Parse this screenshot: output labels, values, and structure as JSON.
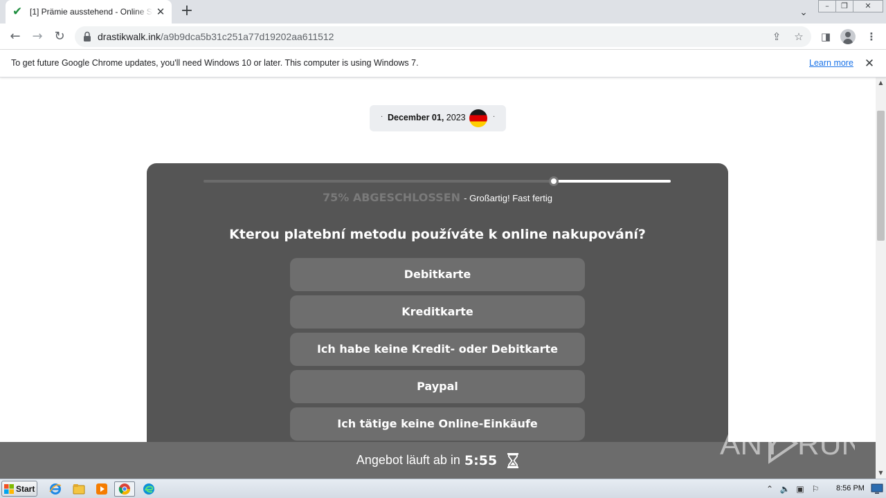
{
  "browser": {
    "tab_title": "[1] Prämie ausstehend - Online Survey",
    "url_host": "drastikwalk.ink",
    "url_path": "/a9b9dca5b31c251a77d19202aa611512"
  },
  "infobar": {
    "message": "To get future Google Chrome updates, you'll need Windows 10 or later. This computer is using Windows 7.",
    "link": "Learn more"
  },
  "page": {
    "date_bold": "December 01,",
    "date_year": "2023",
    "progress": {
      "percent": 75,
      "label": "75% ABGESCHLOSSEN",
      "subtext": "- Großartig! Fast fertig"
    },
    "question": "Kterou platební metodu používáte k online nakupování?",
    "answers": [
      "Debitkarte",
      "Kreditkarte",
      "Ich habe keine Kredit- oder Debitkarte",
      "Paypal",
      "Ich tätige keine Online-Einkäufe"
    ],
    "timer": {
      "label": "Angebot läuft ab in",
      "value": "5:55"
    }
  },
  "watermark": "ANY RUN",
  "taskbar": {
    "start_label": "Start",
    "clock": "8:56 PM"
  },
  "icons": {
    "tab_status": "check-icon",
    "flag": "germany-flag-icon",
    "timer": "hourglass-icon"
  },
  "colors": {
    "card_bg": "#555555",
    "answer_bg": "#6e6e6e",
    "timer_bg": "#6c6c6c",
    "link": "#1a73e8",
    "check": "#1e8e3e"
  }
}
